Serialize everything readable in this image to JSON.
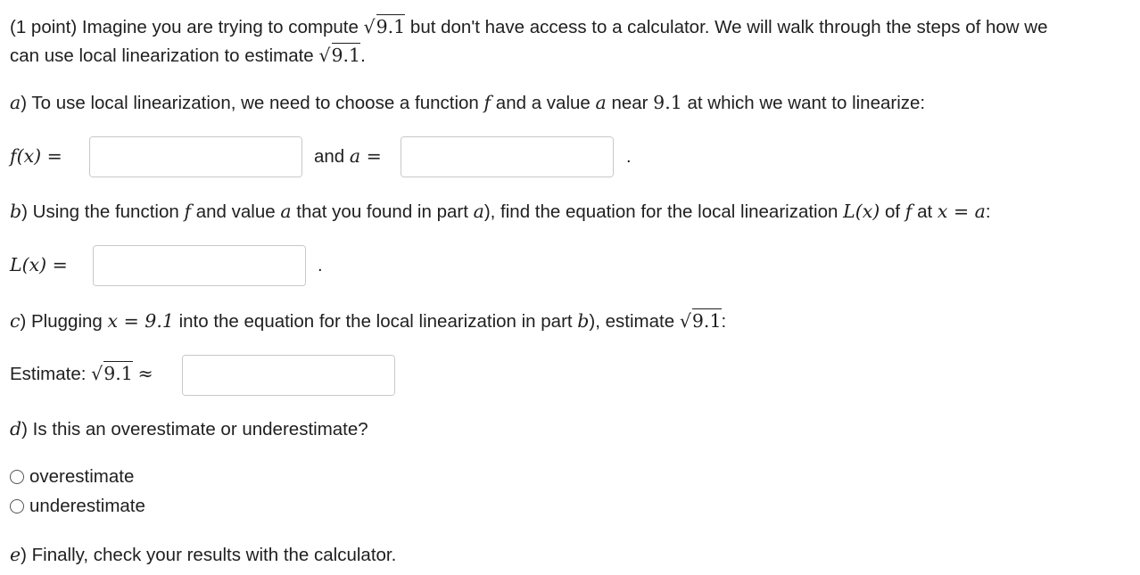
{
  "intro": {
    "p1": "(1 point) Imagine you are trying to compute ",
    "sqrt_arg": "9.1",
    "p2": " but don't have access to a calculator. We will walk through the steps of how we",
    "p3": "can use local linearization to estimate ",
    "p4": "."
  },
  "part_a": {
    "letter": "a",
    "t1": ") To use local linearization, we need to choose a function ",
    "f": "f",
    "t2": " and a value ",
    "a": "a",
    "t3": " near ",
    "num": "9.1",
    "t4": " at which we want to linearize:",
    "f_label": "f(x) =",
    "and": "and ",
    "a_label": "a =",
    "period": "."
  },
  "part_b": {
    "letter": "b",
    "t1": ") Using the function ",
    "f": "f",
    "t2": " and value ",
    "a": "a",
    "t3": " that you found in part ",
    "a2": "a",
    "t4": "), find the equation for the local linearization ",
    "L": "L(x)",
    "t5": " of ",
    "f2": "f",
    "t6": " at ",
    "eq": "x = a",
    "t7": ":",
    "L_label": "L(x) =",
    "period": "."
  },
  "part_c": {
    "letter": "c",
    "t1": ") Plugging ",
    "eq": "x = 9.1",
    "t2": " into the equation for the local linearization in part ",
    "b": "b",
    "t3": "), estimate ",
    "sqrt_arg": "9.1",
    "t4": ":",
    "estimate_label": "Estimate: ",
    "approx": "≈"
  },
  "part_d": {
    "letter": "d",
    "t1": ") Is this an overestimate or underestimate?",
    "options": [
      "overestimate",
      "underestimate"
    ]
  },
  "part_e": {
    "letter": "e",
    "t1": ") Finally, check your results with the calculator."
  },
  "inputs": {
    "f_value": "",
    "a_value": "",
    "L_value": "",
    "estimate_value": ""
  }
}
